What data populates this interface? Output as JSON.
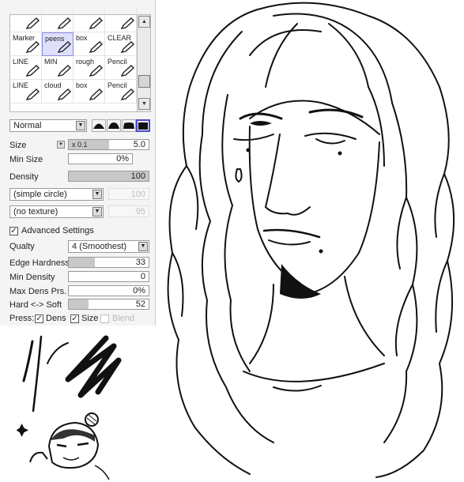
{
  "brushes": [
    {
      "label": "",
      "selected": false
    },
    {
      "label": "",
      "selected": false
    },
    {
      "label": "",
      "selected": false
    },
    {
      "label": "",
      "selected": false
    },
    {
      "label": "Marker",
      "selected": false
    },
    {
      "label": "peens",
      "selected": true
    },
    {
      "label": "box",
      "selected": false
    },
    {
      "label": "CLEAR",
      "selected": false
    },
    {
      "label": "LINE",
      "selected": false
    },
    {
      "label": "MIN",
      "selected": false
    },
    {
      "label": "rough",
      "selected": false
    },
    {
      "label": "Pencil",
      "selected": false
    },
    {
      "label": "LINE",
      "selected": false
    },
    {
      "label": "cloud",
      "selected": false
    },
    {
      "label": "box",
      "selected": false
    },
    {
      "label": "Pencil",
      "selected": false
    }
  ],
  "blend_mode": "Normal",
  "size": {
    "label": "Size",
    "multiplier": "x 0.1",
    "value": "5.0",
    "fill": 0.5
  },
  "min_size": {
    "label": "Min Size",
    "value": "0%",
    "fill": 0
  },
  "density": {
    "label": "Density",
    "value": "100",
    "fill": 1.0
  },
  "shape": {
    "value": "(simple circle)",
    "amount": "100"
  },
  "texture": {
    "value": "(no texture)",
    "amount": "95"
  },
  "advanced": {
    "label": "Advanced Settings",
    "checked": true
  },
  "quality": {
    "label": "Qualty",
    "value": "4 (Smoothest)"
  },
  "edge_hardness": {
    "label": "Edge Hardness",
    "value": "33",
    "fill": 0.33
  },
  "min_density": {
    "label": "Min Density",
    "value": "0",
    "fill": 0
  },
  "max_dens_prs": {
    "label": "Max Dens Prs.",
    "value": "0%",
    "fill": 0
  },
  "hard_soft": {
    "label": "Hard <-> Soft",
    "value": "52",
    "fill": 0.25
  },
  "pressure": {
    "label": "Press:",
    "dens": "Dens",
    "size": "Size",
    "blend": "Blend"
  }
}
